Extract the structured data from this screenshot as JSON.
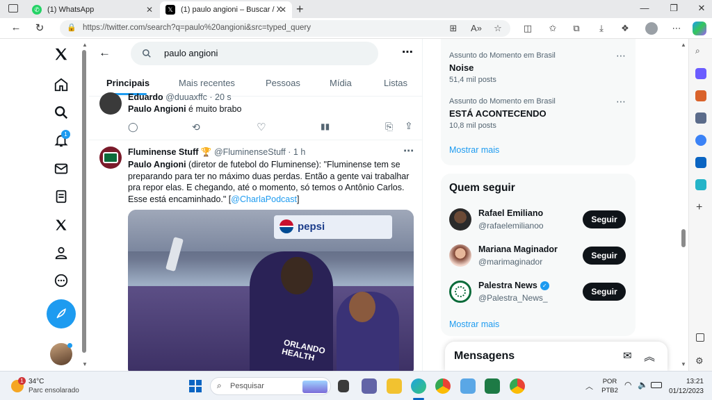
{
  "browser": {
    "tabs": [
      {
        "title": "(1) WhatsApp",
        "active": false
      },
      {
        "title": "(1) paulo angioni – Buscar / X",
        "active": true
      }
    ],
    "url": "https://twitter.com/search?q=paulo%20angioni&src=typed_query"
  },
  "nav": {
    "notification_count": "1"
  },
  "search": {
    "query": "paulo angioni"
  },
  "tabs": [
    "Principais",
    "Mais recentes",
    "Pessoas",
    "Mídia",
    "Listas"
  ],
  "tweets": [
    {
      "name": "Eduardo",
      "handle": "@duuaxffc",
      "time": "20 s",
      "text_bold": "Paulo Angioni",
      "text_rest": " é muito brabo"
    },
    {
      "name": "Fluminense Stuff",
      "badge": "🏆",
      "handle": "@FluminenseStuff",
      "time": "1 h",
      "text_bold": "Paulo Angioni",
      "text_rest": " (diretor de futebol do Fluminense): \"Fluminense tem se preparando para ter no máximo duas perdas. Então a gente vai trabalhar pra repor elas. E chegando, até o momento, só temos o Antônio Carlos. Esse está encaminhado.\" [",
      "mention": "@CharlaPodcast",
      "text_end": "]",
      "image_text_1": "pepsi",
      "image_text_2": "ORLANDO HEALTH"
    }
  ],
  "trends": [
    {
      "category": "Assunto do Momento em Brasil",
      "name": "Noise",
      "count": "51,4 mil posts"
    },
    {
      "category": "Assunto do Momento em Brasil",
      "name": "ESTÁ ACONTECENDO",
      "count": "10,8 mil posts"
    }
  ],
  "show_more": "Mostrar mais",
  "who_to_follow": {
    "title": "Quem seguir",
    "users": [
      {
        "name": "Rafael Emiliano",
        "handle": "@rafaelemilianoo",
        "button": "Seguir"
      },
      {
        "name": "Mariana Maginador",
        "handle": "@marimaginador",
        "button": "Seguir"
      },
      {
        "name": "Palestra News",
        "handle": "@Palestra_News_",
        "button": "Seguir"
      }
    ],
    "show_more": "Mostrar mais"
  },
  "messages": {
    "title": "Mensagens"
  },
  "taskbar": {
    "weather_temp": "34°C",
    "weather_desc": "Parc ensolarado",
    "weather_badge": "1",
    "search_placeholder": "Pesquisar",
    "lang_line1": "POR",
    "lang_line2": "PTB2",
    "time": "13:21",
    "date": "01/12/2023"
  },
  "colors": {
    "accent": "#1d9bf0",
    "dark": "#0f1419",
    "muted": "#536471"
  }
}
